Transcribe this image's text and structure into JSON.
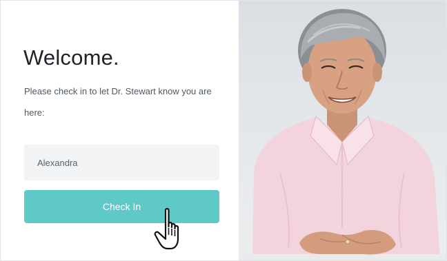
{
  "checkin": {
    "title": "Welcome.",
    "subtitle": "Please check in to let Dr. Stewart know you are here:",
    "name_value": "Alexandra",
    "name_placeholder": "",
    "button_label": "Check In"
  },
  "colors": {
    "accent": "#5fc9c7",
    "field_background": "#f1f3f4",
    "title_text": "#1f2328",
    "body_text": "#4f5861"
  },
  "icons": {
    "cursor": "hand-pointer-icon"
  }
}
